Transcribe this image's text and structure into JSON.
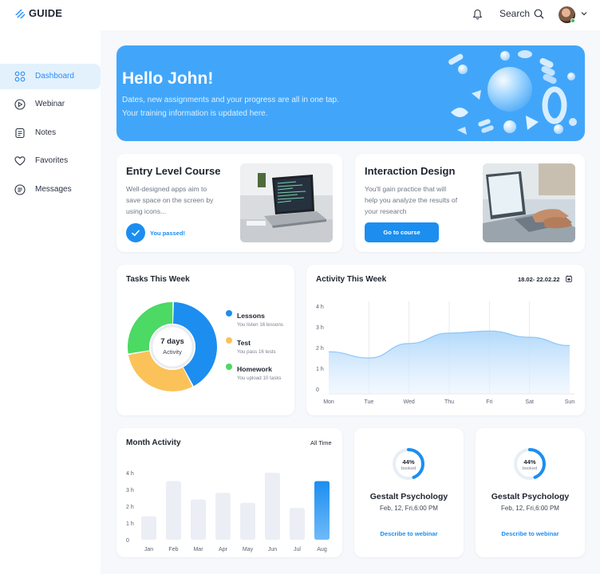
{
  "app": {
    "logo_text": "GUIDE"
  },
  "header": {
    "search_label": "Search"
  },
  "sidebar": {
    "items": [
      {
        "label": "Dashboard",
        "icon": "grid-icon",
        "active": true
      },
      {
        "label": "Webinar",
        "icon": "play-icon"
      },
      {
        "label": "Notes",
        "icon": "notes-icon"
      },
      {
        "label": "Favorites",
        "icon": "heart-icon"
      },
      {
        "label": "Messages",
        "icon": "messages-icon"
      }
    ]
  },
  "hero": {
    "title": "Hello John!",
    "subtitle_line1": "Dates, new assignments and your progress are all in one tap.",
    "subtitle_line2": "Your training information is updated here."
  },
  "courses": [
    {
      "title": "Entry Level Course",
      "desc_line1": "Well-designed apps aim to",
      "desc_line2": "save space on the screen by",
      "desc_line3": "using icons...",
      "status": "You passed!"
    },
    {
      "title": "Interaction Design",
      "desc_line1": "You'll gain practice that will",
      "desc_line2": "help you analyze the results of",
      "desc_line3": "your research",
      "button": "Go to course"
    }
  ],
  "tasks": {
    "title": "Tasks This Week",
    "center_value": "7 days",
    "center_label": "Activity",
    "legend": [
      {
        "name": "Lessons",
        "desc": "You listen 16 lessons",
        "color": "#1c8ef0"
      },
      {
        "name": "Test",
        "desc": "You pass 16 tests",
        "color": "#fbc25a"
      },
      {
        "name": "Homework",
        "desc": "You upload 10 tasks",
        "color": "#4cd964"
      }
    ]
  },
  "activity": {
    "title": "Activity This Week",
    "date_range": "18.02- 22.02.22"
  },
  "month": {
    "title": "Month Activity",
    "filter": "All Time"
  },
  "webinars": [
    {
      "percent": "44%",
      "booked": "booked",
      "title": "Gestalt Psychology",
      "date": "Feb, 12, Fri,6:00 PM",
      "link": "Describe to webinar"
    },
    {
      "percent": "44%",
      "booked": "booked",
      "title": "Gestalt Psychology",
      "date": "Feb, 12, Fri,6:00 PM",
      "link": "Describe to webinar"
    }
  ],
  "chart_data": [
    {
      "type": "pie",
      "title": "Tasks This Week",
      "categories": [
        "Lessons",
        "Test",
        "Homework"
      ],
      "values": [
        42,
        30,
        28
      ]
    },
    {
      "type": "area",
      "title": "Activity This Week",
      "categories": [
        "Mon",
        "Tue",
        "Wed",
        "Thu",
        "Fri",
        "Sat",
        "Sun"
      ],
      "values": [
        1.8,
        1.5,
        2.2,
        2.7,
        2.8,
        2.5,
        2.1
      ],
      "y_ticks": [
        "4 h",
        "3 h",
        "2 h",
        "1 h",
        "0"
      ],
      "ylim": [
        0,
        4
      ],
      "grid": true
    },
    {
      "type": "bar",
      "title": "Month Activity",
      "categories": [
        "Jan",
        "Feb",
        "Mar",
        "Apr",
        "May",
        "Jun",
        "Jul",
        "Aug"
      ],
      "values": [
        1.4,
        3.5,
        2.4,
        2.8,
        2.2,
        4.0,
        1.9,
        3.5
      ],
      "highlight": "Aug",
      "y_ticks": [
        "4 h",
        "3 h",
        "2 h",
        "1 h",
        "0"
      ],
      "ylim": [
        0,
        4
      ]
    }
  ]
}
